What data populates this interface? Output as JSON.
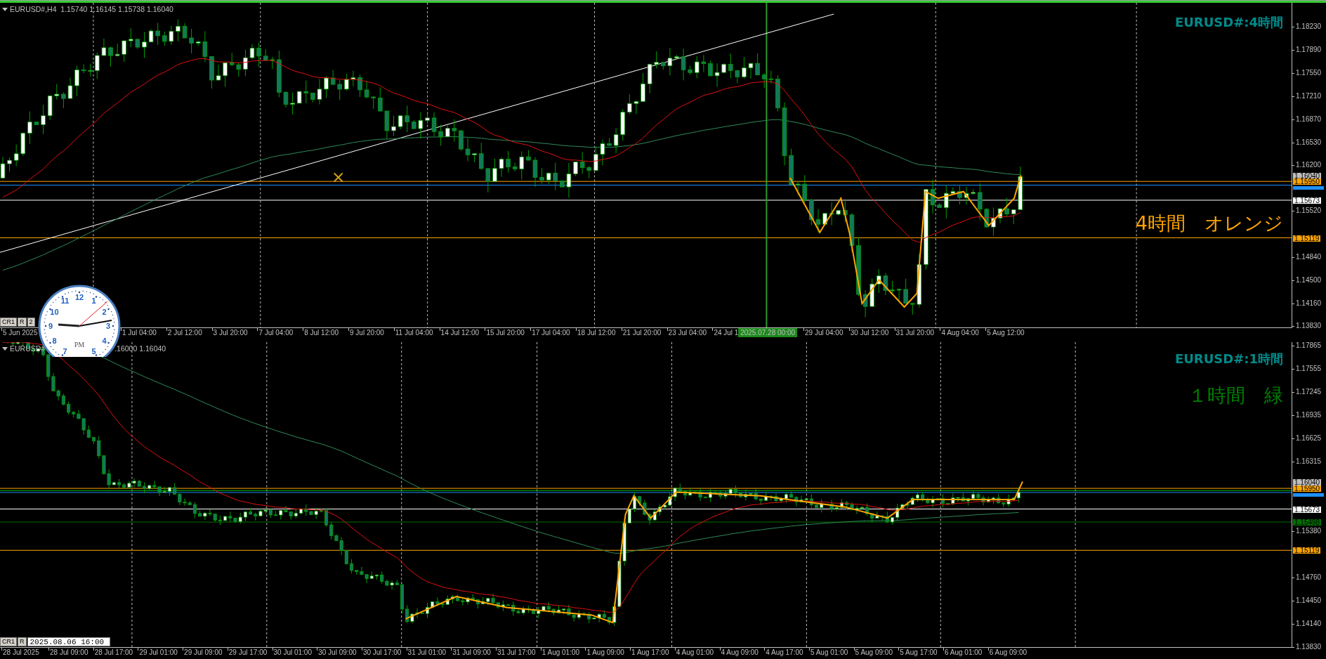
{
  "panels": [
    {
      "header": [
        "EURUSD#,H4  1.15740 1.16145 1.15738 1.16040"
      ],
      "symbol_label": "EURUSD#:4時間",
      "note": {
        "text": "4時間　オレンジ",
        "color": "#ffa500"
      },
      "buttons": [
        "CR1",
        "R",
        "2"
      ],
      "price_ticks": [
        "1.18230",
        "1.17890",
        "1.17550",
        "1.17210",
        "1.16870",
        "1.16530",
        "1.16200",
        "1.15520",
        "1.14840",
        "1.14500",
        "1.14160",
        "1.13830"
      ],
      "price_tags": [
        {
          "label": "1.16040",
          "color": "#c0c0c0"
        },
        {
          "label": "1.15950",
          "color": "#ffa500"
        },
        {
          "label": "1.15673",
          "color": "#ffffff"
        },
        {
          "label": "1.15119",
          "color": "#ffa500"
        }
      ],
      "time_labels": [
        {
          "label": "5 Jun 2025",
          "kind": "date"
        },
        {
          "label": "1 Jul 04:00",
          "kind": "date"
        },
        {
          "label": "2 Jul 12:00",
          "kind": "date"
        },
        {
          "label": "3 Jul 20:00",
          "kind": "date"
        },
        {
          "label": "7 Jul 04:00",
          "kind": "date"
        },
        {
          "label": "8 Jul 12:00",
          "kind": "date"
        },
        {
          "label": "9 Jul 20:00",
          "kind": "date"
        },
        {
          "label": "11 Jul 04:00",
          "kind": "date"
        },
        {
          "label": "14 Jul 12:00",
          "kind": "date"
        },
        {
          "label": "15 Jul 20:00",
          "kind": "date"
        },
        {
          "label": "17 Jul 04:00",
          "kind": "date"
        },
        {
          "label": "18 Jul 12:00",
          "kind": "date"
        },
        {
          "label": "21 Jul 20:00",
          "kind": "date"
        },
        {
          "label": "23 Jul 04:00",
          "kind": "date"
        },
        {
          "label": "24 Jul 1",
          "kind": "date"
        },
        {
          "label": "2025.07.28 00:00",
          "kind": "tag"
        },
        {
          "label": "29 Jul 04:00",
          "kind": "date"
        },
        {
          "label": "30 Jul 12:00",
          "kind": "date"
        },
        {
          "label": "31 Jul 20:00",
          "kind": "date"
        },
        {
          "label": "4 Aug 04:00",
          "kind": "date"
        },
        {
          "label": "5 Aug 12:00",
          "kind": "date"
        }
      ]
    },
    {
      "header": [
        "EURUSD#",
        ".16000 1.16040"
      ],
      "symbol_label": "EURUSD#:1時間",
      "note": {
        "text": "１時間　緑",
        "color": "#008000"
      },
      "buttons": [
        "CR1",
        "R"
      ],
      "date_field": {
        "value": "2025.08.06 16:00"
      },
      "price_ticks": [
        "1.17865",
        "1.17555",
        "1.17245",
        "1.16935",
        "1.16625",
        "1.16315",
        "1.15380",
        "1.14760",
        "1.14450",
        "1.14140",
        "1.13830"
      ],
      "price_tags": [
        {
          "label": "1.16040",
          "color": "#c0c0c0"
        },
        {
          "label": "1.15950",
          "color": "#ffa500"
        },
        {
          "label": "1.15673",
          "color": "#ffffff"
        },
        {
          "label": "1.15498",
          "color": "#007000"
        },
        {
          "label": "1.15119",
          "color": "#ffa500"
        }
      ],
      "time_labels": [
        {
          "label": "28 Jul 2025",
          "kind": "date"
        },
        {
          "label": "28 Jul 09:00",
          "kind": "date"
        },
        {
          "label": "28 Jul 17:00",
          "kind": "date"
        },
        {
          "label": "29 Jul 01:00",
          "kind": "date"
        },
        {
          "label": "29 Jul 09:00",
          "kind": "date"
        },
        {
          "label": "29 Jul 17:00",
          "kind": "date"
        },
        {
          "label": "30 Jul 01:00",
          "kind": "date"
        },
        {
          "label": "30 Jul 09:00",
          "kind": "date"
        },
        {
          "label": "30 Jul 17:00",
          "kind": "date"
        },
        {
          "label": "31 Jul 01:00",
          "kind": "date"
        },
        {
          "label": "31 Jul 09:00",
          "kind": "date"
        },
        {
          "label": "31 Jul 17:00",
          "kind": "date"
        },
        {
          "label": "1 Aug 01:00",
          "kind": "date"
        },
        {
          "label": "1 Aug 09:00",
          "kind": "date"
        },
        {
          "label": "1 Aug 17:00",
          "kind": "date"
        },
        {
          "label": "4 Aug 01:00",
          "kind": "date"
        },
        {
          "label": "4 Aug 09:00",
          "kind": "date"
        },
        {
          "label": "4 Aug 17:00",
          "kind": "date"
        },
        {
          "label": "5 Aug 01:00",
          "kind": "date"
        },
        {
          "label": "5 Aug 09:00",
          "kind": "date"
        },
        {
          "label": "5 Aug 17:00",
          "kind": "date"
        },
        {
          "label": "6 Aug 01:00",
          "kind": "date"
        },
        {
          "label": "6 Aug 09:00",
          "kind": "date"
        }
      ]
    }
  ],
  "clock": {
    "numerals": [
      "12",
      "1",
      "2",
      "3",
      "4",
      "5",
      "7",
      "8",
      "9",
      "10",
      "11"
    ],
    "period": "PM"
  }
}
